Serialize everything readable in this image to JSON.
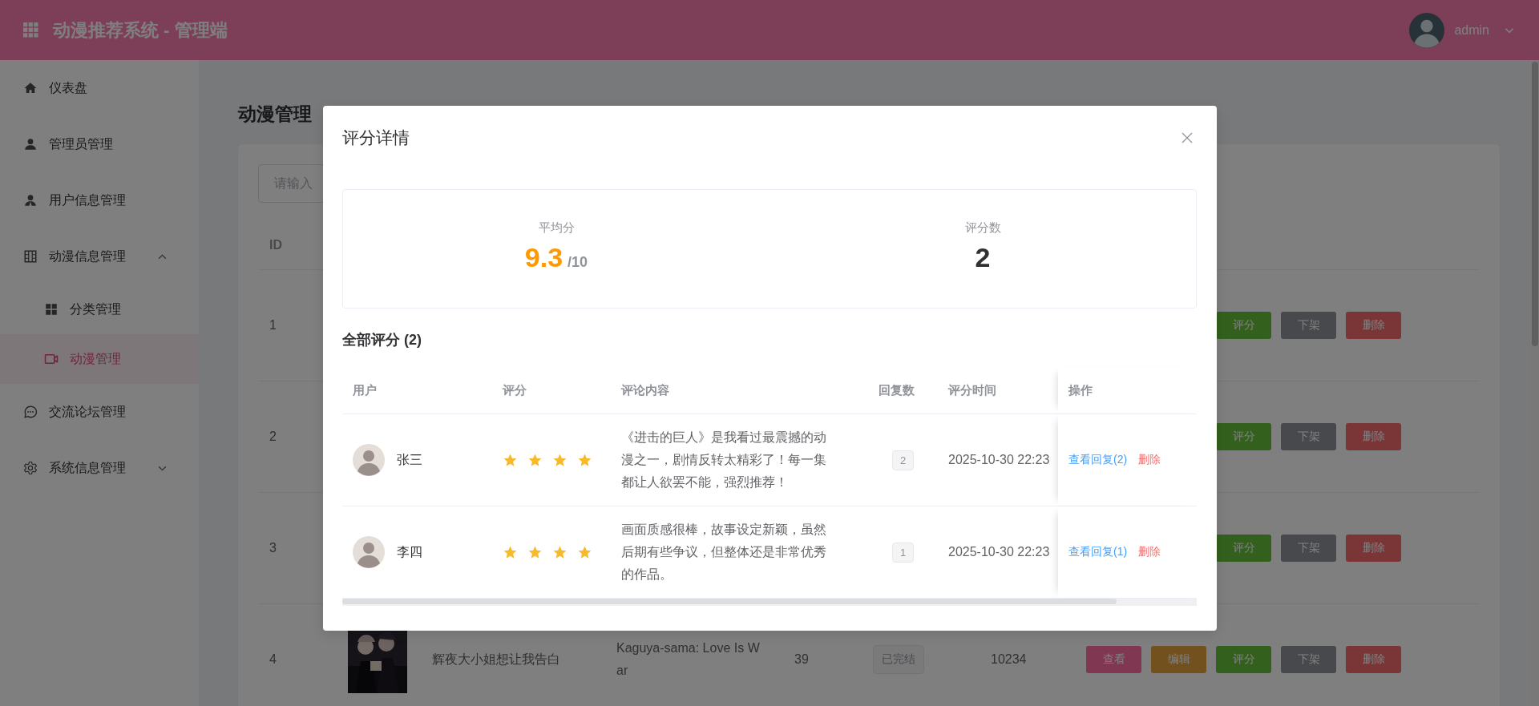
{
  "header": {
    "title": "动漫推荐系统 - 管理端",
    "user": "admin"
  },
  "sidebar": {
    "items": [
      {
        "label": "仪表盘",
        "selected": false
      },
      {
        "label": "管理员管理",
        "selected": false
      },
      {
        "label": "用户信息管理",
        "selected": false
      },
      {
        "label": "动漫信息管理",
        "selected": false,
        "expanded": true,
        "children": [
          {
            "label": "分类管理",
            "selected": false
          },
          {
            "label": "动漫管理",
            "selected": true
          }
        ]
      },
      {
        "label": "交流论坛管理",
        "selected": false
      },
      {
        "label": "系统信息管理",
        "selected": false,
        "expanded": false
      }
    ]
  },
  "page": {
    "title": "动漫管理",
    "search": {
      "placeholder": "请输入"
    },
    "table": {
      "columns": [
        "ID"
      ],
      "rows": [
        {
          "id": "1",
          "actions": [
            {
              "label": "评分",
              "kind": "success"
            },
            {
              "label": "下架",
              "kind": "info"
            },
            {
              "label": "删除",
              "kind": "danger"
            }
          ]
        },
        {
          "id": "2",
          "actions": [
            {
              "label": "评分",
              "kind": "success"
            },
            {
              "label": "下架",
              "kind": "info"
            },
            {
              "label": "删除",
              "kind": "danger"
            }
          ]
        },
        {
          "id": "3",
          "actions": [
            {
              "label": "评分",
              "kind": "success"
            },
            {
              "label": "下架",
              "kind": "info"
            },
            {
              "label": "删除",
              "kind": "danger"
            }
          ]
        },
        {
          "id": "4",
          "cover": {
            "kind": "picture"
          },
          "name": "辉夜大小姐想让我告白",
          "title_en": "Kaguya-sama: Love Is War",
          "episodes": "39",
          "status": "已完结",
          "views": "10234",
          "actions": [
            {
              "label": "查看",
              "kind": "primary"
            },
            {
              "label": "编辑",
              "kind": "warning"
            },
            {
              "label": "评分",
              "kind": "success"
            },
            {
              "label": "下架",
              "kind": "info"
            },
            {
              "label": "删除",
              "kind": "danger"
            }
          ]
        }
      ]
    }
  },
  "dialog": {
    "title": "评分详情",
    "stats": [
      {
        "label": "平均分",
        "value": "9.3",
        "suffix": "/10",
        "kind": "score"
      },
      {
        "label": "评分数",
        "value": "2",
        "kind": "count"
      }
    ],
    "section_title": "全部评分 (2)",
    "table": {
      "columns": [
        "用户",
        "评分",
        "评论内容",
        "回复数",
        "评分时间",
        "操作"
      ],
      "rows": [
        {
          "user": "张三",
          "stars": 4,
          "comment": "《进击的巨人》是我看过最震撼的动漫之一，剧情反转太精彩了！每一集都让人欲罢不能，强烈推荐！",
          "replies": "2",
          "time": "2025-10-30 22:23",
          "actions": [
            {
              "label": "查看回复(2)",
              "kind": "primary"
            },
            {
              "label": "删除",
              "kind": "danger"
            }
          ]
        },
        {
          "user": "李四",
          "stars": 4,
          "comment": "画面质感很棒，故事设定新颖，虽然后期有些争议，但整体还是非常优秀的作品。",
          "replies": "1",
          "time": "2025-10-30 22:23",
          "actions": [
            {
              "label": "查看回复(1)",
              "kind": "primary"
            },
            {
              "label": "删除",
              "kind": "danger"
            }
          ]
        }
      ]
    }
  }
}
